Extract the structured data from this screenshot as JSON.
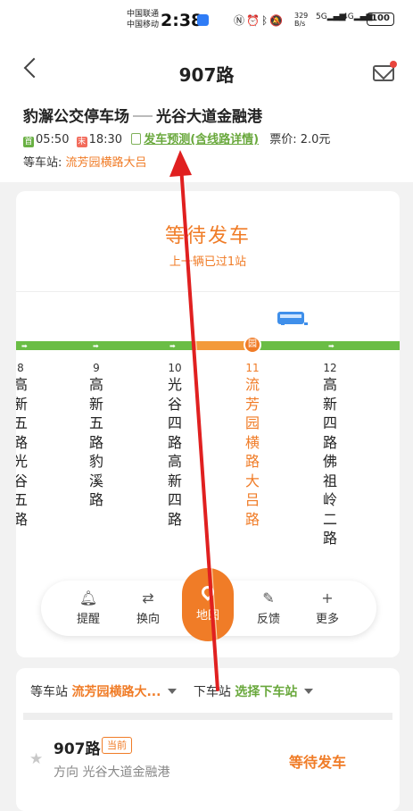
{
  "status_bar": {
    "carrier1": "中国联通",
    "carrier2": "中国移动",
    "time": "2:38",
    "net_speed_value": "329",
    "net_speed_unit": "B/s",
    "sig1": "5G",
    "sig2": "4G",
    "battery": "100"
  },
  "header": {
    "title": "907路",
    "origin": "豹澥公交停车场",
    "destination": "光谷大道金融港",
    "first_tag": "首",
    "first_time": "05:50",
    "last_tag": "末",
    "last_time": "18:30",
    "predict_link": "发车预测(含线路详情)",
    "price": "票价: 2.0元",
    "wait_label": "等车站:",
    "wait_stop": "流芳园横路大吕"
  },
  "main": {
    "status_title": "等待发车",
    "status_sub": "上一辆已过1站",
    "stops": [
      {
        "num": "8",
        "name": "高新五路光谷五路"
      },
      {
        "num": "9",
        "name": "高新五路豹溪路"
      },
      {
        "num": "10",
        "name": "光谷四路高新四路"
      },
      {
        "num": "11",
        "name": "流芳园横路大吕路"
      },
      {
        "num": "12",
        "name": "高新四路佛祖岭二路"
      }
    ],
    "current_marker": "园",
    "toolbar": {
      "remind": "提醒",
      "switch": "换向",
      "map": "地图",
      "feedback": "反馈",
      "more": "更多"
    }
  },
  "bottom": {
    "wait_label": "等车站",
    "wait_value": "流芳园横路大...",
    "off_label": "下车站",
    "off_value": "选择下车站",
    "line": "907路",
    "now_tag": "当前",
    "direction": "方向 光谷大道金融港",
    "state": "等待发车"
  },
  "colors": {
    "accent": "#f07c27",
    "track_green": "#6abd45",
    "link_green": "#69a83c",
    "annotation_red": "#e02020"
  }
}
